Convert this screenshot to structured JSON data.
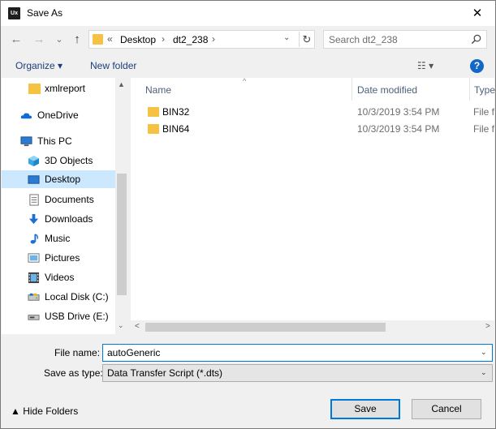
{
  "window": {
    "app_icon_text": "Ux",
    "title": "Save As",
    "close_glyph": "✕"
  },
  "address": {
    "back_glyph": "←",
    "forward_glyph": "→",
    "recent_glyph": "⌄",
    "up_glyph": "↑",
    "overflow": "«",
    "crumbs": [
      "Desktop",
      "dt2_238"
    ],
    "separator": "›",
    "dropdown_glyph": "⌄",
    "refresh_glyph": "↻",
    "search_placeholder": "Search dt2_238"
  },
  "toolbar": {
    "organize": "Organize ▾",
    "new_folder": "New folder",
    "view_glyph": "☷ ▾",
    "help_glyph": "?"
  },
  "nav": {
    "items": [
      {
        "label": "xmlreport",
        "icon": "folder-icon"
      },
      {
        "label": "OneDrive",
        "icon": "cloud-icon"
      },
      {
        "label": "This PC",
        "icon": "computer-icon"
      },
      {
        "label": "3D Objects",
        "icon": "cube-icon"
      },
      {
        "label": "Desktop",
        "icon": "desktop-icon",
        "selected": true
      },
      {
        "label": "Documents",
        "icon": "document-icon"
      },
      {
        "label": "Downloads",
        "icon": "download-icon"
      },
      {
        "label": "Music",
        "icon": "music-icon"
      },
      {
        "label": "Pictures",
        "icon": "pictures-icon"
      },
      {
        "label": "Videos",
        "icon": "video-icon"
      },
      {
        "label": "Local Disk (C:)",
        "icon": "disk-icon"
      },
      {
        "label": "USB Drive (E:)",
        "icon": "usb-drive-icon"
      }
    ],
    "scroll_up": "▲",
    "scroll_down": "⌄"
  },
  "columns": {
    "name": "Name",
    "date": "Date modified",
    "type": "Type",
    "sort_glyph": "^"
  },
  "files": [
    {
      "name": "BIN32",
      "date": "10/3/2019 3:54 PM",
      "type": "File fo"
    },
    {
      "name": "BIN64",
      "date": "10/3/2019 3:54 PM",
      "type": "File fo"
    }
  ],
  "hscroll": {
    "left": "<",
    "right": ">"
  },
  "form": {
    "file_name_label": "File name:",
    "file_name_value": "autoGeneric",
    "save_type_label": "Save as type:",
    "save_type_value": "Data Transfer Script (*.dts)",
    "dd_glyph": "⌄"
  },
  "footer": {
    "hide_folders": "▲  Hide Folders",
    "save": "Save",
    "cancel": "Cancel"
  },
  "colors": {
    "accent": "#0078d7",
    "selection": "#cce8ff",
    "folder": "#f5c243",
    "link": "#1a3e7c"
  }
}
